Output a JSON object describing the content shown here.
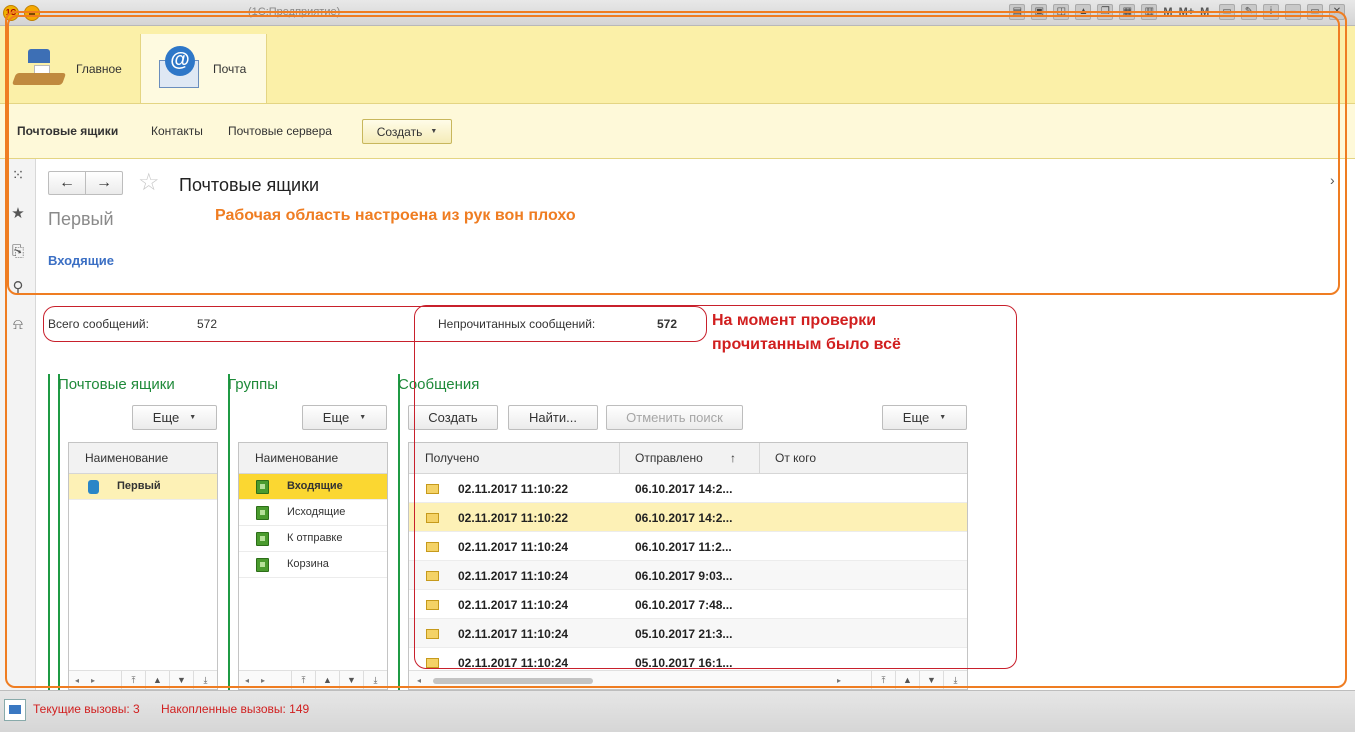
{
  "window": {
    "title": "(1С:Предприятие)",
    "logo_text": "1С",
    "toolbar_labels": [
      "M",
      "M+",
      "M-"
    ]
  },
  "sections": [
    {
      "label": "Главное",
      "icon": "desk-lamp-icon"
    },
    {
      "label": "Почта",
      "icon": "mail-at-icon"
    }
  ],
  "function_panel": {
    "items": [
      "Почтовые ящики",
      "Контакты",
      "Почтовые сервера"
    ],
    "create_label": "Создать"
  },
  "workspace": {
    "title": "Почтовые ящики",
    "subtitle": "Первый",
    "link": "Входящие"
  },
  "annotations": {
    "workspace_note": "Рабочая область настроена из рук вон плохо",
    "check_note_line1": "На момент проверки",
    "check_note_line2": "прочитанным было всё"
  },
  "stats": {
    "total_label": "Всего сообщений:",
    "total_value": "572",
    "unread_label": "Непрочитанных сообщений:",
    "unread_value": "572"
  },
  "mailboxes": {
    "title": "Почтовые ящики",
    "more_label": "Еще",
    "column": "Наименование",
    "rows": [
      "Первый"
    ]
  },
  "groups": {
    "title": "Группы",
    "more_label": "Еще",
    "column": "Наименование",
    "rows": [
      "Входящие",
      "Исходящие",
      "К отправке",
      "Корзина"
    ]
  },
  "messages": {
    "title": "Сообщения",
    "create_label": "Создать",
    "find_label": "Найти...",
    "cancel_search_label": "Отменить поиск",
    "more_label": "Еще",
    "columns": [
      "Получено",
      "Отправлено",
      "От кого"
    ],
    "sort_indicator": "↑",
    "rows": [
      {
        "received": "02.11.2017 11:10:22",
        "sent": "06.10.2017 14:2..."
      },
      {
        "received": "02.11.2017 11:10:22",
        "sent": "06.10.2017 14:2..."
      },
      {
        "received": "02.11.2017 11:10:24",
        "sent": "06.10.2017 11:2..."
      },
      {
        "received": "02.11.2017 11:10:24",
        "sent": "06.10.2017 9:03..."
      },
      {
        "received": "02.11.2017 11:10:24",
        "sent": "06.10.2017 7:48..."
      },
      {
        "received": "02.11.2017 11:10:24",
        "sent": "05.10.2017 21:3..."
      },
      {
        "received": "02.11.2017 11:10:24",
        "sent": "05.10.2017 16:1..."
      }
    ]
  },
  "statusbar": {
    "current_calls": "Текущие вызовы: 3",
    "accumulated_calls": "Накопленные вызовы: 149"
  },
  "colors": {
    "annotation_orange": "#ef7d22",
    "annotation_red": "#d11f1f",
    "group_title_green": "#1f8a3a",
    "link_blue": "#3b6fc4",
    "sections_bg": "#fbf0a8"
  }
}
